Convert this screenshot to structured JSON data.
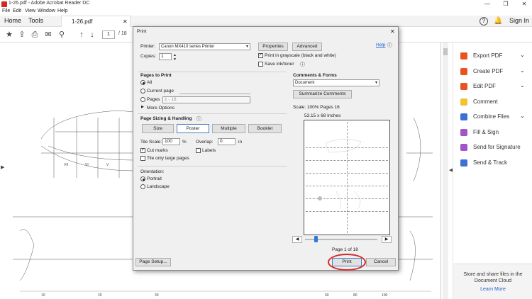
{
  "window": {
    "title": "1-26.pdf - Adobe Acrobat Reader DC",
    "controls": [
      "—",
      "❐",
      "✕"
    ]
  },
  "menu": [
    "File",
    "Edit",
    "View",
    "Window",
    "Help"
  ],
  "tabs": {
    "home": "Home",
    "tools": "Tools",
    "doc": "1-26.pdf",
    "doc_close": "✕",
    "sign_in": "Sign In"
  },
  "toolbar": {
    "page_value": "1",
    "page_total": "/ 18"
  },
  "right_panel": {
    "items": [
      {
        "label": "Export PDF",
        "icon": "export-pdf-icon",
        "color": "#e8541f",
        "chevron": true
      },
      {
        "label": "Create PDF",
        "icon": "create-pdf-icon",
        "color": "#e8541f",
        "chevron": true
      },
      {
        "label": "Edit PDF",
        "icon": "edit-pdf-icon",
        "color": "#e8541f",
        "chevron": true
      },
      {
        "label": "Comment",
        "icon": "comment-icon",
        "color": "#f2c233",
        "chevron": false
      },
      {
        "label": "Combine Files",
        "icon": "combine-files-icon",
        "color": "#3d6fd4",
        "chevron": true
      },
      {
        "label": "Fill & Sign",
        "icon": "fill-sign-icon",
        "color": "#9f56c7",
        "chevron": false
      },
      {
        "label": "Send for Signature",
        "icon": "send-signature-icon",
        "color": "#9f56c7",
        "chevron": false
      },
      {
        "label": "Send & Track",
        "icon": "send-track-icon",
        "color": "#3d6fd4",
        "chevron": false
      }
    ],
    "cloud_text": "Store and share files in the Document Cloud",
    "cloud_link": "Learn More"
  },
  "dialog": {
    "title": "Print",
    "close": "✕",
    "printer_label": "Printer:",
    "printer_value": "Canon MX410 series Printer",
    "properties": "Properties",
    "advanced": "Advanced",
    "help": "Help",
    "copies_label": "Copies:",
    "copies_value": "1",
    "grayscale_label": "Print in grayscale (black and white)",
    "grayscale_checked": true,
    "save_ink_label": "Save ink/toner",
    "save_ink_checked": false,
    "pages_to_print": "Pages to Print",
    "all": "All",
    "current_page": "Current page",
    "pages": "Pages",
    "pages_range": "1 - 18",
    "more_options": "More Options",
    "sizing_header": "Page Sizing & Handling",
    "size": "Size",
    "poster": "Poster",
    "multiple": "Multiple",
    "booklet": "Booklet",
    "tile_scale_label": "Tile Scale:",
    "tile_scale_value": "100",
    "tile_scale_unit": "%",
    "overlap_label": "Overlap:",
    "overlap_value": "0",
    "overlap_unit": "in",
    "cut_marks": "Cut marks",
    "cut_marks_checked": true,
    "labels": "Labels",
    "labels_checked": false,
    "tile_large": "Tile only large pages",
    "tile_large_checked": false,
    "orientation": "Orientation:",
    "portrait": "Portrait",
    "landscape": "Landscape",
    "comments_forms": "Comments & Forms",
    "comments_value": "Document",
    "summarize": "Summarize Comments",
    "scale_text": "Scale: 100% Pages 16",
    "dims": "53.15 x 68 Inches",
    "page_indicator": "Page 1 of 18",
    "page_setup": "Page Setup...",
    "print": "Print",
    "cancel": "Cancel"
  },
  "colors": {
    "accent_blue": "#2d7bd4",
    "highlight_ring": "#d42a2a",
    "acrobat_red": "#d02a20"
  }
}
